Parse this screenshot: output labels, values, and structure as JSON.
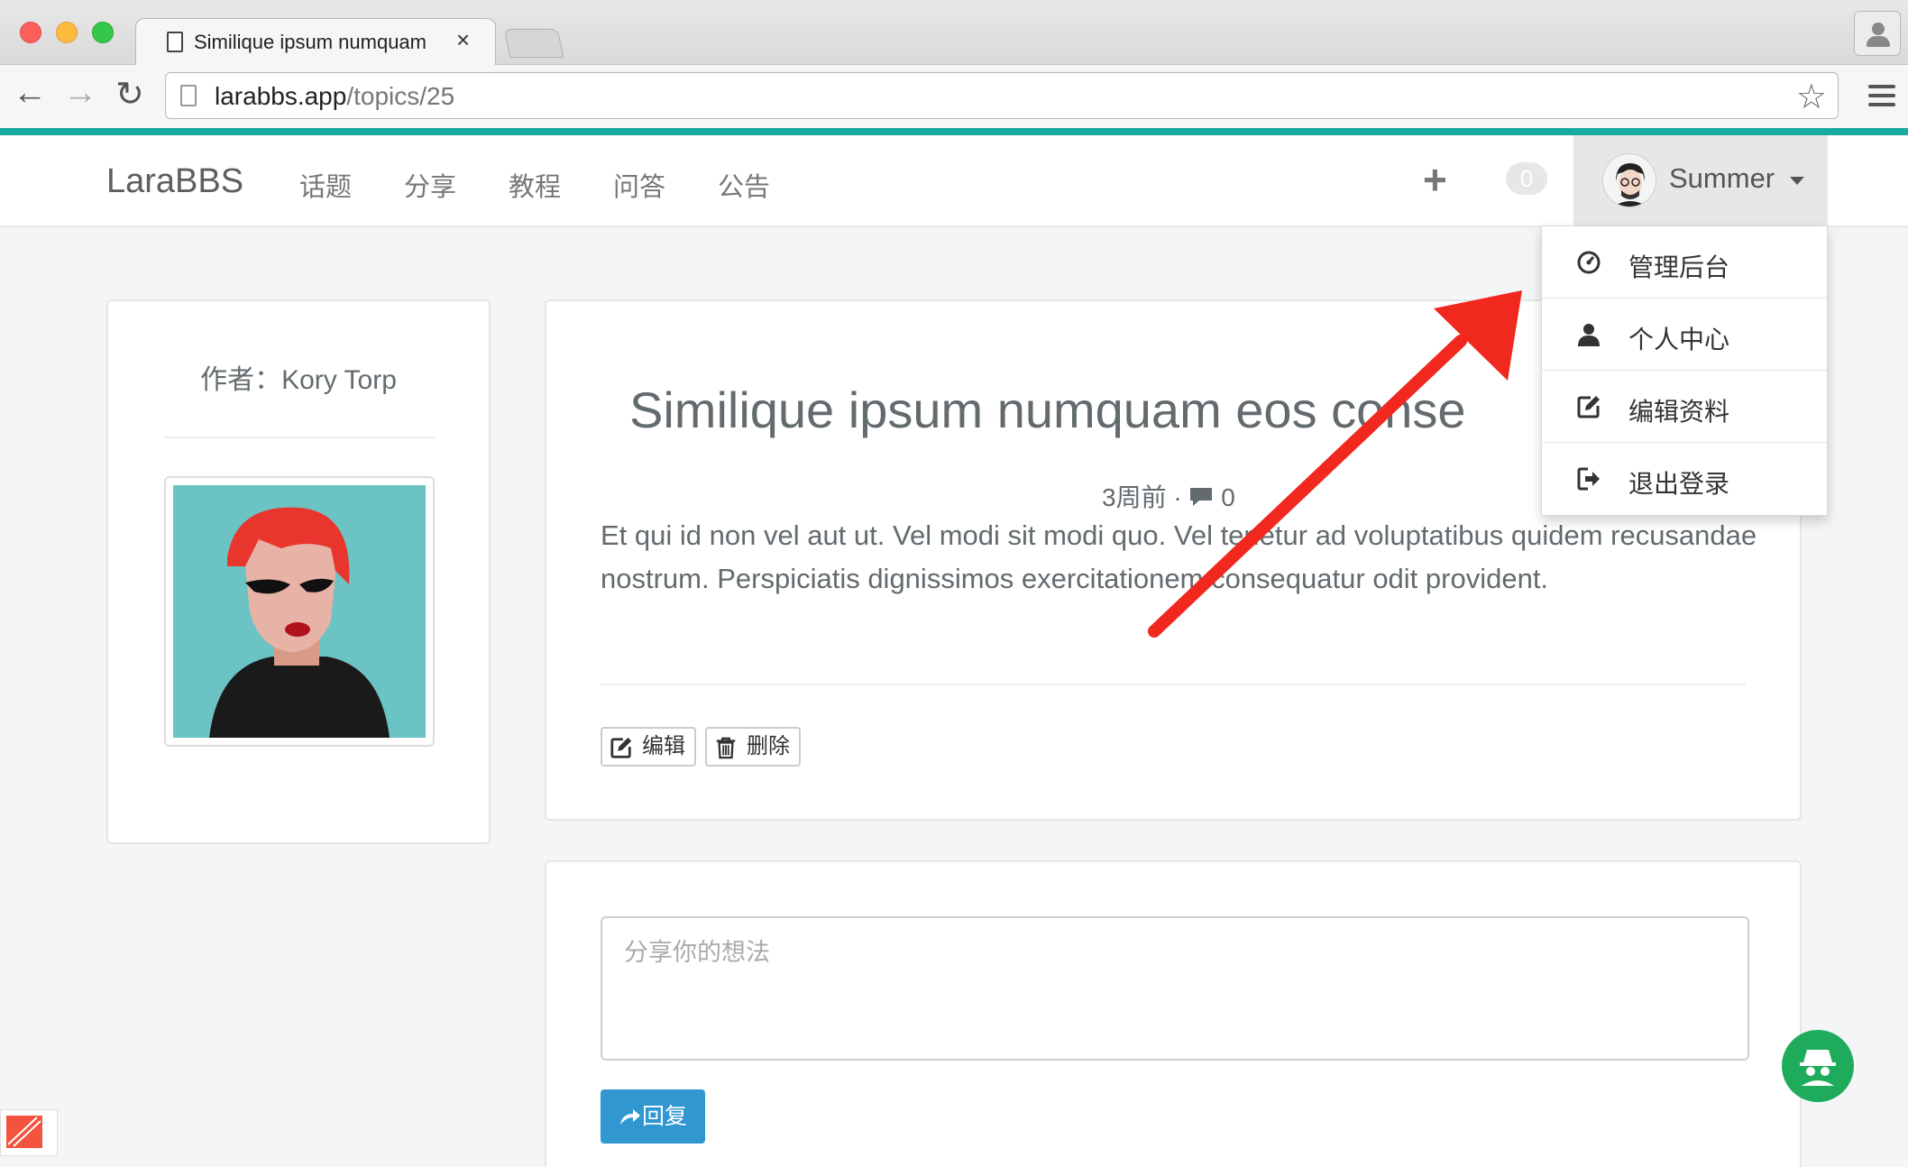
{
  "browser": {
    "tab_title": "Similique ipsum numquam e",
    "tab_close": "×",
    "url_host": "larabbs.app",
    "url_path": "/topics/25",
    "back": "←",
    "forward": "→",
    "reload": "↻",
    "star": "☆"
  },
  "navbar": {
    "brand": "LaraBBS",
    "items": [
      "话题",
      "分享",
      "教程",
      "问答",
      "公告"
    ],
    "plus": "+",
    "notification_count": "0",
    "user_name": "Summer"
  },
  "dropdown": {
    "items": [
      {
        "label": "管理后台",
        "icon": "dashboard-icon"
      },
      {
        "label": "个人中心",
        "icon": "user-icon"
      },
      {
        "label": "编辑资料",
        "icon": "edit-icon"
      },
      {
        "label": "退出登录",
        "icon": "logout-icon"
      }
    ]
  },
  "author": {
    "label": "作者：Kory Torp"
  },
  "topic": {
    "title": "Similique ipsum numquam eos conse",
    "time": "3周前",
    "separator": "·",
    "reply_count": "0",
    "body": "Et qui id non vel aut ut. Vel modi sit modi quo. Vel tenetur ad voluptatibus quidem recusandae nostrum. Perspiciatis dignissimos exercitationem consequatur odit provident.",
    "edit_label": "编辑",
    "delete_label": "删除"
  },
  "reply": {
    "placeholder": "分享你的想法",
    "button_label": "回复"
  },
  "colors": {
    "accent_teal": "#1aaba0",
    "primary_blue": "#3097d1",
    "fab_green": "#1eab5b",
    "annotation_red": "#f0281e"
  }
}
